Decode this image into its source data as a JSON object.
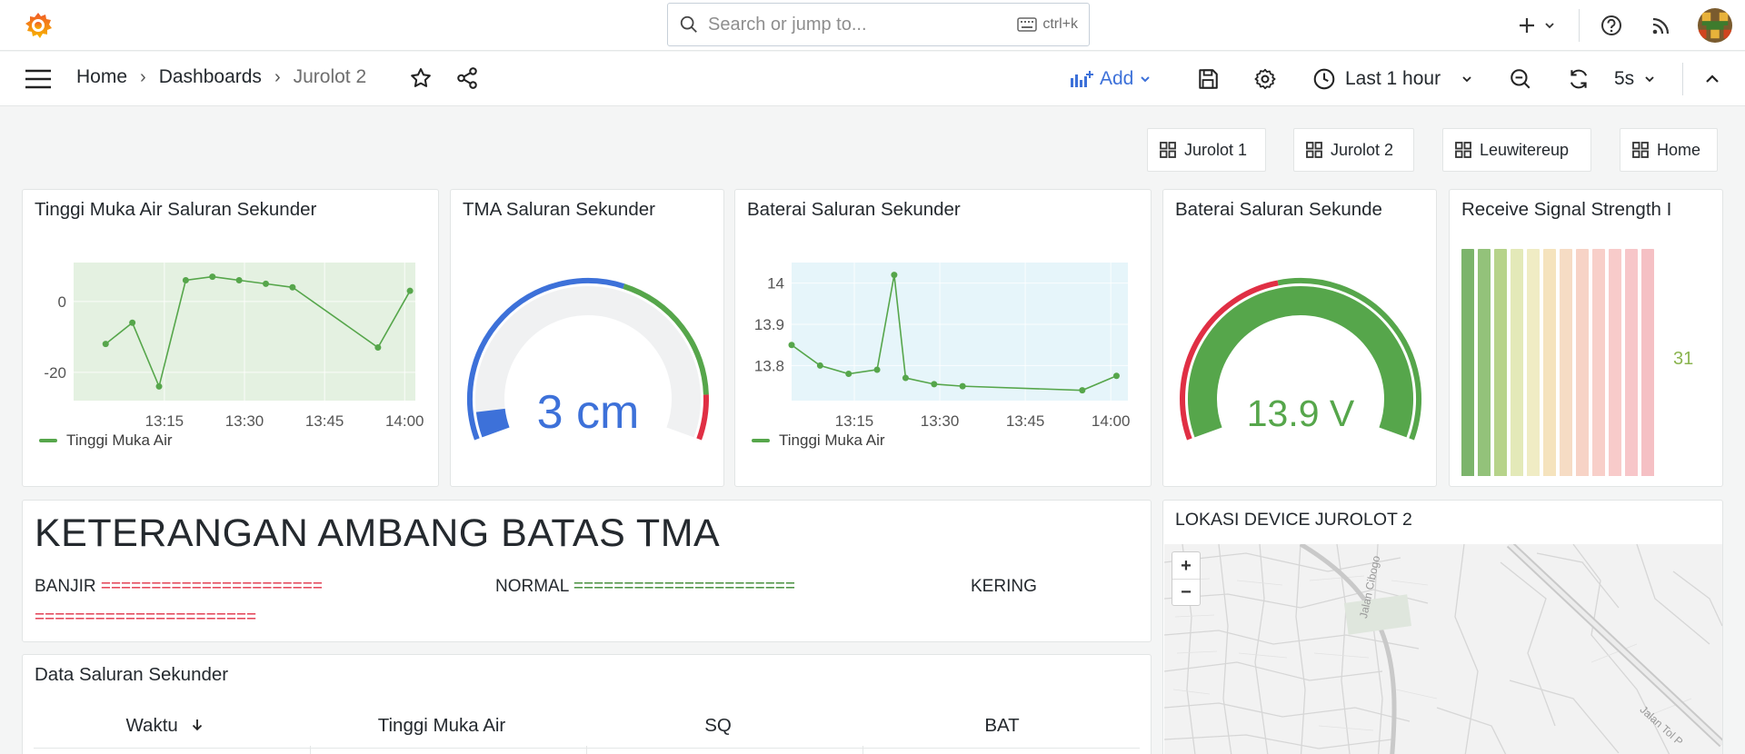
{
  "search": {
    "placeholder": "Search or jump to...",
    "shortcut": "ctrl+k"
  },
  "breadcrumb": {
    "home": "Home",
    "dashboards": "Dashboards",
    "current": "Jurolot 2"
  },
  "toolbar": {
    "add_label": "Add",
    "time_range": "Last 1 hour",
    "refresh_interval": "5s"
  },
  "dashboard_links": [
    "Jurolot 1",
    "Jurolot 2",
    "Leuwitereup",
    "Home"
  ],
  "panels": {
    "tma_chart": {
      "title": "Tinggi Muka Air Saluran Sekunder",
      "legend": "Tinggi Muka Air"
    },
    "tma_gauge": {
      "title": "TMA Saluran Sekunder",
      "value": "3 cm"
    },
    "bat_chart": {
      "title": "Baterai Saluran Sekunder",
      "legend": "Tinggi Muka Air"
    },
    "bat_gauge": {
      "title": "Baterai Saluran Sekunde",
      "value": "13.9 V"
    },
    "rssi": {
      "title": "Receive Signal Strength I",
      "value": "31"
    },
    "threshold": {
      "heading": "KETERANGAN AMBANG BATAS TMA",
      "banjir": "BANJIR",
      "normal": "NORMAL",
      "kering": "KERING",
      "red_bar": "======================",
      "green_bar": "======================",
      "red_bar2": "======================"
    },
    "table": {
      "title": "Data Saluran Sekunder",
      "columns": [
        "Waktu",
        "Tinggi Muka Air",
        "SQ",
        "BAT"
      ]
    },
    "map": {
      "title": "LOKASI DEVICE JUROLOT 2",
      "zoom_in": "+",
      "zoom_out": "−",
      "street1": "Jalan Cibogo",
      "street2": "Jalan Tol P"
    }
  },
  "chart_data": [
    {
      "type": "line",
      "title": "Tinggi Muka Air Saluran Sekunder",
      "series": [
        {
          "name": "Tinggi Muka Air",
          "x": [
            "13:04",
            "13:09",
            "13:14",
            "13:19",
            "13:24",
            "13:29",
            "13:34",
            "13:39",
            "13:55",
            "14:01"
          ],
          "values": [
            -12,
            -6,
            -24,
            6,
            7,
            6,
            5,
            4,
            -13,
            3
          ]
        }
      ],
      "x_ticks": [
        "13:15",
        "13:30",
        "13:45",
        "14:00"
      ],
      "y_ticks": [
        0,
        -20
      ],
      "ylim": [
        -28,
        11
      ],
      "colors": {
        "line": "#56a64b",
        "fill": "#e4f1e1"
      },
      "legend": "bottom"
    },
    {
      "type": "gauge",
      "title": "TMA Saluran Sekunder",
      "value": 3,
      "unit": "cm",
      "min": 0,
      "max": 100,
      "thresholds": [
        {
          "to": 60,
          "color": "#3d71d9"
        },
        {
          "to": 90,
          "color": "#56a64b"
        },
        {
          "to": 100,
          "color": "#e02f44"
        }
      ]
    },
    {
      "type": "line",
      "title": "Baterai Saluran Sekunder",
      "series": [
        {
          "name": "Tinggi Muka Air",
          "x": [
            "13:04",
            "13:09",
            "13:14",
            "13:19",
            "13:22",
            "13:24",
            "13:29",
            "13:34",
            "13:55",
            "14:01"
          ],
          "values": [
            13.85,
            13.8,
            13.78,
            13.79,
            14.02,
            13.77,
            13.755,
            13.75,
            13.74,
            13.775
          ]
        }
      ],
      "x_ticks": [
        "13:15",
        "13:30",
        "13:45",
        "14:00"
      ],
      "y_ticks": [
        14,
        13.9,
        13.8
      ],
      "ylim": [
        13.715,
        14.05
      ],
      "colors": {
        "line": "#56a64b",
        "fill": "#e6f5fa"
      },
      "legend": "bottom"
    },
    {
      "type": "gauge",
      "title": "Baterai Saluran Sekunde",
      "value": 13.9,
      "unit": "V",
      "thresholds": [
        {
          "color": "#e02f44"
        },
        {
          "color": "#56a64b"
        }
      ]
    },
    {
      "type": "bar-gauge",
      "title": "Receive Signal Strength I",
      "value": 31,
      "colors": [
        "#56a64b",
        "#8ab44f",
        "#c5d15e",
        "#ebe7a8",
        "#f3d8b0",
        "#f5c7bf"
      ]
    }
  ]
}
